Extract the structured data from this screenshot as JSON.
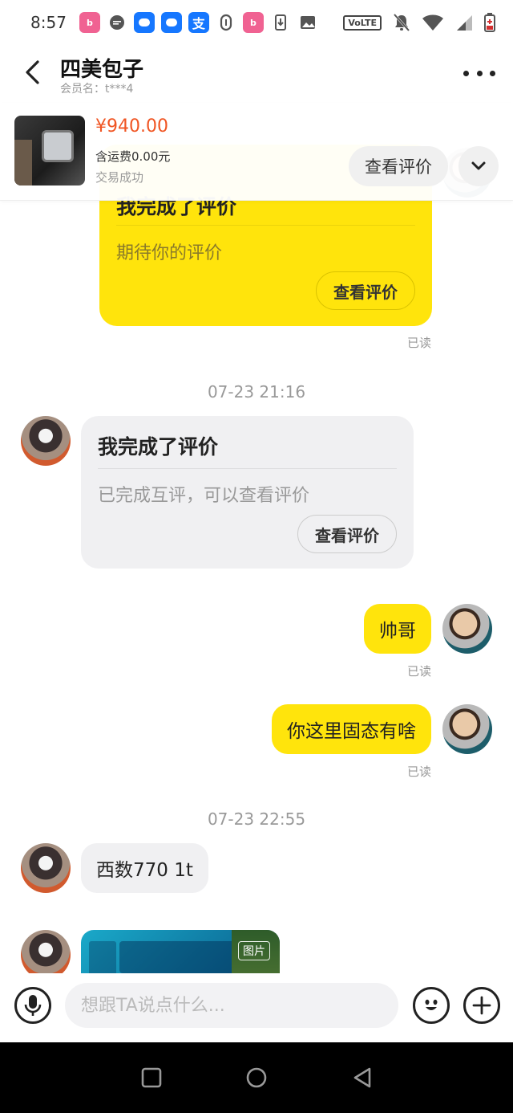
{
  "status_bar": {
    "time": "8:57",
    "volte": "VoLTE"
  },
  "header": {
    "title": "四美包子",
    "subtitle": "会员名：t***4"
  },
  "product": {
    "price": "¥940.00",
    "shipping": "含运费0.00元",
    "trade_status": "交易成功",
    "view_review_label": "查看评价"
  },
  "messages": {
    "card1": {
      "title": "我完成了评价",
      "desc": "期待你的评价",
      "button": "查看评价",
      "read": "已读"
    },
    "time1": "07-23 21:16",
    "card2": {
      "title": "我完成了评价",
      "desc": "已完成互评，可以查看评价",
      "button": "查看评价"
    },
    "msg_shuaige": {
      "text": "帅哥",
      "read": "已读"
    },
    "msg_gutai": {
      "text": "你这里固态有啥",
      "read": "已读"
    },
    "time2": "07-23 22:55",
    "msg_xishu": {
      "text": "西数770 1t"
    },
    "image_badge": "图片"
  },
  "input_bar": {
    "placeholder": "想跟TA说点什么..."
  },
  "colors": {
    "accent_yellow": "#ffe40c",
    "price_orange": "#f05523",
    "bubble_gray": "#f0f0f2"
  }
}
